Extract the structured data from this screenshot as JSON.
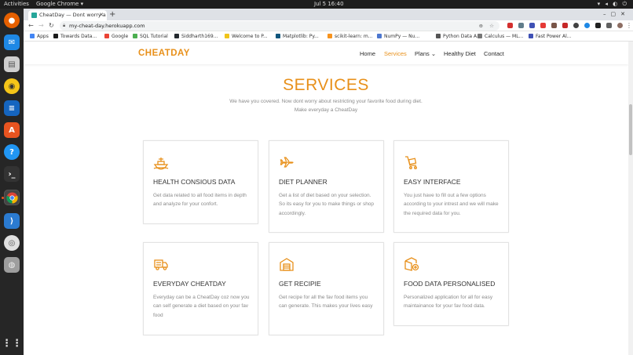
{
  "os": {
    "activities": "Activities",
    "app_menu": "Google Chrome ▾",
    "clock": "Jul 5  16:40"
  },
  "browser": {
    "tab_title": "CheatDay — Dont worry a",
    "url": "my-cheat-day.herokuapp.com",
    "bookmarks": [
      {
        "label": "Apps",
        "color": "#4285f4"
      },
      {
        "label": "Towards Data...",
        "color": "#1a1a1a"
      },
      {
        "label": "Google",
        "color": "#ea4335"
      },
      {
        "label": "SQL Tutorial",
        "color": "#4caf50"
      },
      {
        "label": "Siddharth169...",
        "color": "#24292e"
      },
      {
        "label": "Welcome to P...",
        "color": "#f0c419"
      },
      {
        "label": "Matplotlib: Py...",
        "color": "#11557c"
      },
      {
        "label": "scikit-learn: m...",
        "color": "#f7931e"
      },
      {
        "label": "NumPy — Nu...",
        "color": "#4d77cf"
      },
      {
        "label": "Python Data A...",
        "color": "#555555"
      },
      {
        "label": "Calculus — ML...",
        "color": "#777777"
      },
      {
        "label": "Fast Power Al...",
        "color": "#3f51b5"
      }
    ]
  },
  "site": {
    "logo": "CHEATDAY",
    "nav": [
      {
        "label": "Home",
        "active": false
      },
      {
        "label": "Services",
        "active": true
      },
      {
        "label": "Plans ⌄",
        "active": false
      },
      {
        "label": "Healthy Diet",
        "active": false
      },
      {
        "label": "Contact",
        "active": false
      }
    ],
    "accent_color": "#e8901a",
    "section_title": "SERVICES",
    "section_subtitle_line1": "We have you covered. Now dont worry about restricting your favorite food during diet.",
    "section_subtitle_line2": "Make everyday a CheatDay"
  },
  "services": [
    {
      "icon": "ship-icon",
      "title": "HEALTH CONSIOUS DATA",
      "description": "Get data related to all food items in depth and analyze for your confort."
    },
    {
      "icon": "plane-icon",
      "title": "DIET PLANNER",
      "description": "Get a list of diet based on your selection. So its easy for you to make things or shop accordingly."
    },
    {
      "icon": "cart-icon",
      "title": "EASY INTERFACE",
      "description": "You just have to fill out a few options according to your intrest and we will make the required data for you."
    },
    {
      "icon": "truck-icon",
      "title": "EVERYDAY CHEATDAY",
      "description": "Everyday can be a CheatDay coz now you can self generate a diet based on your fav food"
    },
    {
      "icon": "warehouse-icon",
      "title": "GET RECIPIE",
      "description": "Get recipe for all the fav food items you can generate. This makes your lives easy"
    },
    {
      "icon": "box-add-icon",
      "title": "FOOD DATA PERSONALISED",
      "description": "Personalized application for all for easy maintainance for your fav food data."
    }
  ]
}
